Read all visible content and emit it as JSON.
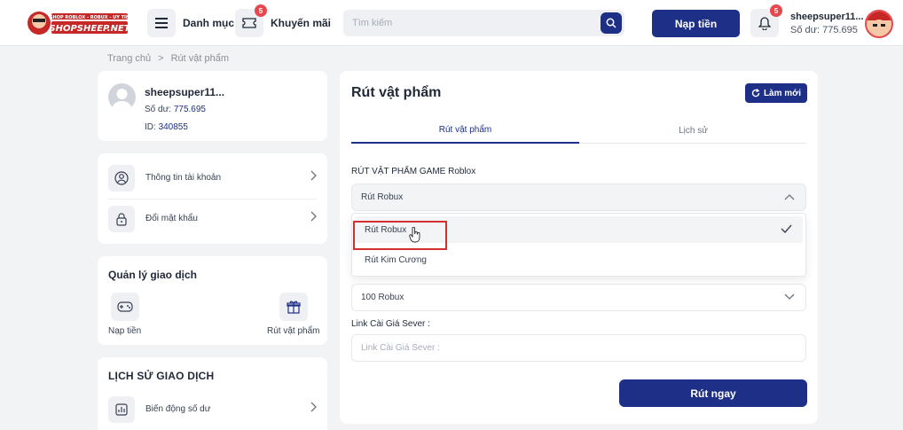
{
  "header": {
    "logo_text": "SHOPSHEEP.NET",
    "logo_tagline": "SHOP ROBLOX - ROBUX - UY TÍN",
    "menu_label": "Danh mục",
    "promo_label": "Khuyến mãi",
    "promo_badge": "5",
    "search_placeholder": "Tìm kiếm",
    "deposit_label": "Nạp tiền",
    "notif_badge": "5",
    "username": "sheepsuper11...",
    "balance": "Số dư: 775.695"
  },
  "breadcrumb": {
    "home": "Trang chủ",
    "sep": ">",
    "current": "Rút vật phẩm"
  },
  "profile": {
    "username": "sheepsuper11...",
    "balance_label": "Số dư: ",
    "balance_value": "775.695",
    "id_label": "ID: ",
    "id_value": "340855"
  },
  "account_menu": [
    {
      "label": "Thông tin tài khoản",
      "icon": "user-circle-icon"
    },
    {
      "label": "Đổi mật khẩu",
      "icon": "lock-icon"
    }
  ],
  "transactions": {
    "title": "Quản lý giao dịch",
    "items": [
      {
        "label": "Nạp tiền",
        "icon": "gamepad-icon"
      },
      {
        "label": "Rút vật phẩm",
        "icon": "gift-icon"
      }
    ]
  },
  "history": {
    "title": "LỊCH SỬ GIAO DỊCH",
    "items": [
      {
        "label": "Biến động số dư",
        "icon": "chart-icon"
      }
    ]
  },
  "main": {
    "title": "Rút vật phẩm",
    "refresh_label": "Làm mới",
    "tabs": [
      {
        "label": "Rút vật phẩm",
        "active": true
      },
      {
        "label": "Lịch sử",
        "active": false
      }
    ],
    "game_label": "RÚT VẬT PHẨM GAME Roblox",
    "type_select_value": "Rút Robux",
    "type_options": [
      {
        "label": "Rút Robux",
        "selected": true
      },
      {
        "label": "Rút Kim Cương",
        "selected": false
      }
    ],
    "amount_select_value": "100 Robux",
    "link_label": "Link Cài Giá Sever :",
    "link_placeholder": "Link Cài Giá Sever :",
    "submit_label": "Rút ngay"
  },
  "colors": {
    "primary": "#1d2f86",
    "badge": "#e5484d",
    "highlight": "#d32f2f"
  }
}
